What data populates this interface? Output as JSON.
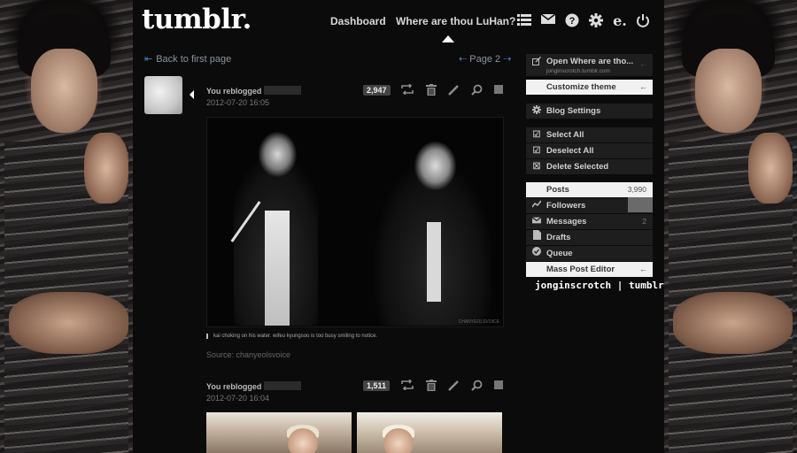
{
  "header": {
    "logo": "tumblr.",
    "nav_dashboard": "Dashboard",
    "nav_blog": "Where are thou LuHan?",
    "icons": [
      "list-icon",
      "mail-icon",
      "help-icon",
      "gear-icon",
      "edit-icon",
      "power-icon"
    ]
  },
  "navigation": {
    "back_label": "Back to first page",
    "back_arrow": "⇤",
    "page_label": "Page 2",
    "prev_arrow": "⇠",
    "next_arrow": "⇢"
  },
  "posts": [
    {
      "reblog_text": "You reblogged",
      "date": "2012-07-20 16:05",
      "notes": "2,947",
      "caption": "kai choking on his water. wifeu kyungsoo is too busy smiling to notice.",
      "source": "Source: chanyeolsvoice",
      "watermark": "CHANYEOLSVOICE"
    },
    {
      "reblog_text": "You reblogged",
      "date": "2012-07-20 16:04",
      "notes": "1,511"
    }
  ],
  "post_controls": [
    "reblog-icon",
    "delete-icon",
    "edit-icon",
    "search-icon",
    "square-icon"
  ],
  "sidebar": {
    "open_label": "Open Where are tho...",
    "open_sub": "jonginscrotch.tumblr.com",
    "customize": "Customize theme",
    "settings": "Blog Settings",
    "select_all": "Select All",
    "deselect_all": "Deselect All",
    "delete_selected": "Delete Selected",
    "posts": "Posts",
    "posts_count": "3,990",
    "followers": "Followers",
    "messages": "Messages",
    "messages_count": "2",
    "drafts": "Drafts",
    "queue": "Queue",
    "mass_post_editor": "Mass Post Editor",
    "arrow": "←",
    "signature": "jonginscrotch | tumblr"
  },
  "colors": {
    "accent_blue": "#4a7fc1",
    "background": "#0b0b0b",
    "highlight": "#f1f1f1"
  }
}
